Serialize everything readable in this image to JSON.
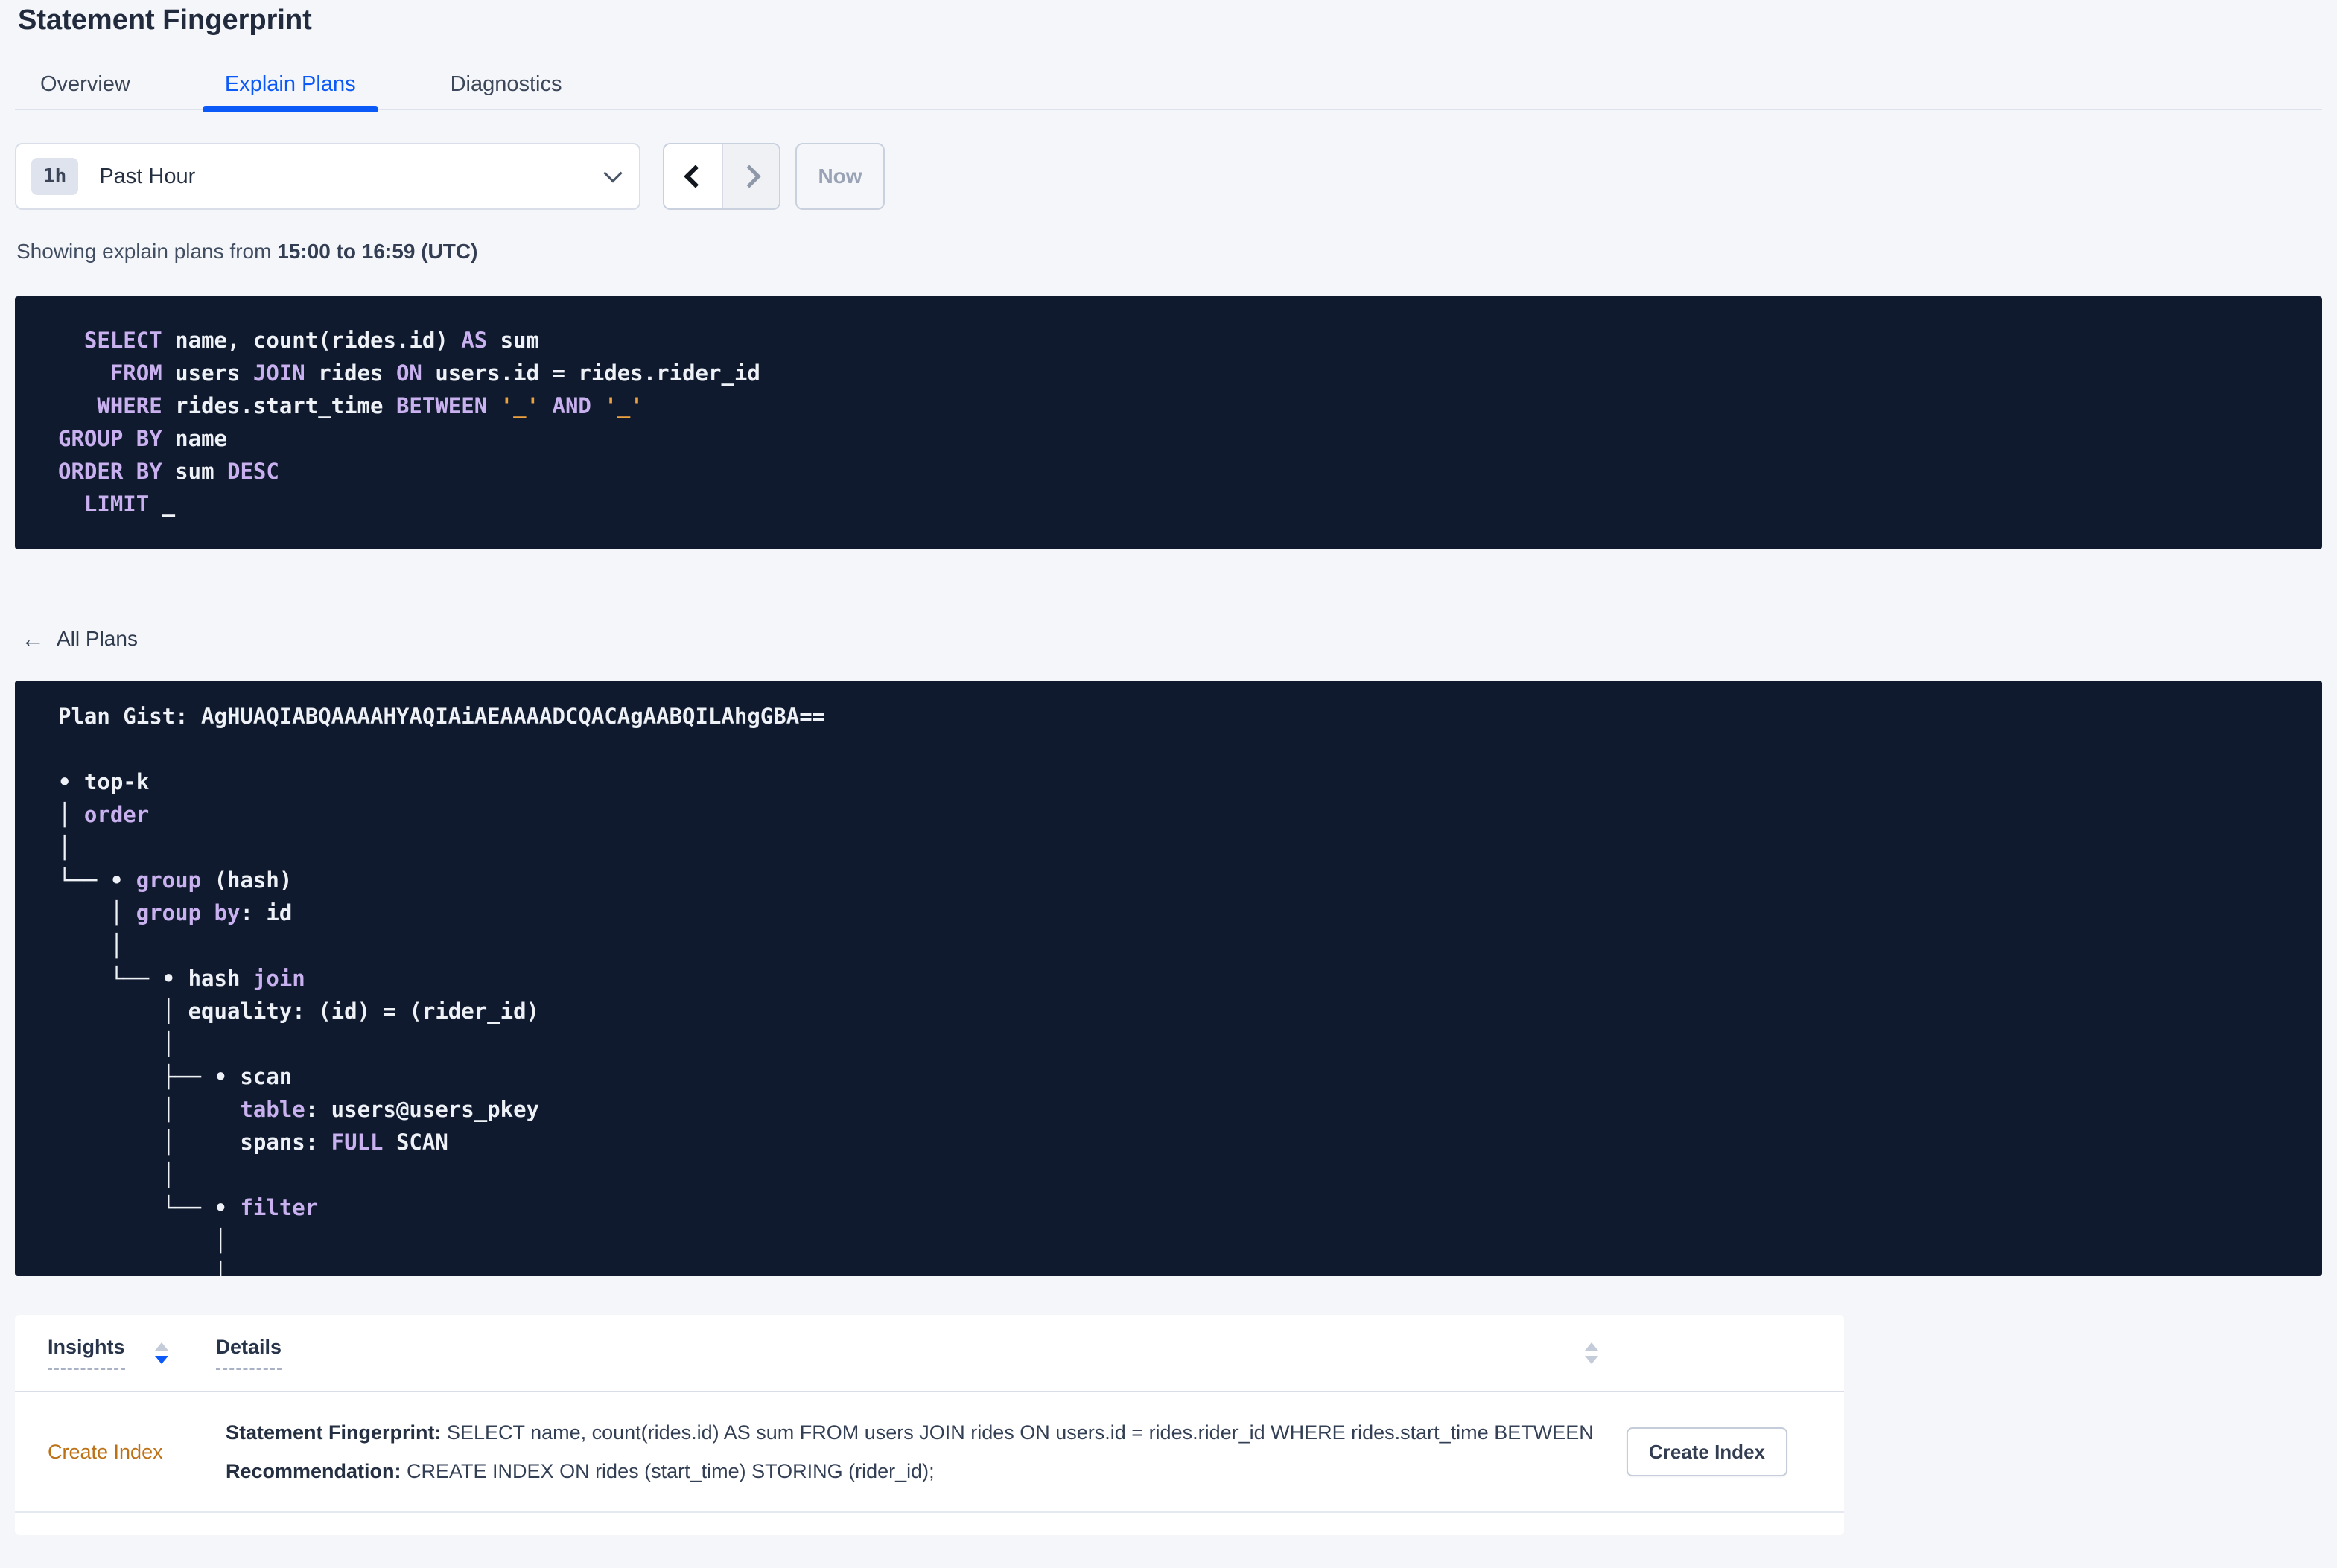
{
  "header": {
    "title": "Statement Fingerprint"
  },
  "tabs": {
    "overview": "Overview",
    "explain_plans": "Explain Plans",
    "diagnostics": "Diagnostics"
  },
  "time_picker": {
    "range_badge": "1h",
    "range_label": "Past Hour",
    "now_label": "Now"
  },
  "subheader": {
    "prefix": "Showing explain plans from ",
    "range": "15:00 to 16:59 (UTC)"
  },
  "sql_statement": {
    "lines": [
      [
        {
          "c": "kw",
          "t": "  SELECT"
        },
        {
          "c": "tx",
          "t": " name, count(rides.id) "
        },
        {
          "c": "kw",
          "t": "AS"
        },
        {
          "c": "tx",
          "t": " sum"
        }
      ],
      [
        {
          "c": "kw",
          "t": "    FROM"
        },
        {
          "c": "tx",
          "t": " users "
        },
        {
          "c": "kw",
          "t": "JOIN"
        },
        {
          "c": "tx",
          "t": " rides "
        },
        {
          "c": "kw",
          "t": "ON"
        },
        {
          "c": "tx",
          "t": " users.id = rides.rider_id"
        }
      ],
      [
        {
          "c": "kw",
          "t": "   WHERE"
        },
        {
          "c": "tx",
          "t": " rides.start_time "
        },
        {
          "c": "kw",
          "t": "BETWEEN"
        },
        {
          "c": "tx",
          "t": " "
        },
        {
          "c": "st",
          "t": "'_'"
        },
        {
          "c": "tx",
          "t": " "
        },
        {
          "c": "kw",
          "t": "AND"
        },
        {
          "c": "tx",
          "t": " "
        },
        {
          "c": "st",
          "t": "'_'"
        }
      ],
      [
        {
          "c": "kw",
          "t": "GROUP BY"
        },
        {
          "c": "tx",
          "t": " name"
        }
      ],
      [
        {
          "c": "kw",
          "t": "ORDER BY"
        },
        {
          "c": "tx",
          "t": " sum "
        },
        {
          "c": "kw",
          "t": "DESC"
        }
      ],
      [
        {
          "c": "kw",
          "t": "  LIMIT"
        },
        {
          "c": "tx",
          "t": " _"
        }
      ]
    ]
  },
  "back_link": {
    "arrow": "←",
    "label": "All Plans"
  },
  "plan": {
    "gist": "Plan Gist: AgHUAQIABQAAAAHYAQIAiAEAAAADCQACAgAABQILAhgGBA==",
    "lines": [
      [
        {
          "c": "tx",
          "t": "Plan Gist: AgHUAQIABQAAAAHYAQIAiAEAAAADCQACAgAABQILAhgGBA=="
        }
      ],
      [],
      [
        {
          "c": "tx",
          "t": "• top-k"
        }
      ],
      [
        {
          "c": "tx",
          "t": "│ "
        },
        {
          "c": "kw",
          "t": "order"
        }
      ],
      [
        {
          "c": "tx",
          "t": "│"
        }
      ],
      [
        {
          "c": "tx",
          "t": "└── • "
        },
        {
          "c": "kw",
          "t": "group"
        },
        {
          "c": "tx",
          "t": " (hash)"
        }
      ],
      [
        {
          "c": "tx",
          "t": "    │ "
        },
        {
          "c": "kw",
          "t": "group by"
        },
        {
          "c": "tx",
          "t": ": id"
        }
      ],
      [
        {
          "c": "tx",
          "t": "    │"
        }
      ],
      [
        {
          "c": "tx",
          "t": "    └── • hash "
        },
        {
          "c": "kw",
          "t": "join"
        }
      ],
      [
        {
          "c": "tx",
          "t": "        │ equality: (id) = (rider_id)"
        }
      ],
      [
        {
          "c": "tx",
          "t": "        │"
        }
      ],
      [
        {
          "c": "tx",
          "t": "        ├── • scan"
        }
      ],
      [
        {
          "c": "tx",
          "t": "        │     "
        },
        {
          "c": "kw",
          "t": "table"
        },
        {
          "c": "tx",
          "t": ": users@users_pkey"
        }
      ],
      [
        {
          "c": "tx",
          "t": "        │     spans: "
        },
        {
          "c": "kw",
          "t": "FULL"
        },
        {
          "c": "tx",
          "t": " SCAN"
        }
      ],
      [
        {
          "c": "tx",
          "t": "        │"
        }
      ],
      [
        {
          "c": "tx",
          "t": "        └── • "
        },
        {
          "c": "kw",
          "t": "filter"
        }
      ],
      [
        {
          "c": "tx",
          "t": "            │"
        }
      ],
      [
        {
          "c": "tx",
          "t": "            │"
        }
      ]
    ]
  },
  "insights_table": {
    "col_insights": "Insights",
    "col_details": "Details",
    "row": {
      "insight": "Create Index",
      "fingerprint_label": "Statement Fingerprint:",
      "fingerprint_value": " SELECT name, count(rides.id) AS sum FROM users JOIN rides ON users.id = rides.rider_id WHERE rides.start_time BETWEEN '_…",
      "recommendation_label": "Recommendation:",
      "recommendation_value": " CREATE INDEX ON rides (start_time) STORING (rider_id);",
      "action": "Create Index"
    }
  },
  "colors": {
    "accent_blue": "#0b59f7",
    "code_bg": "#0f1a2e",
    "code_keyword": "#c9b1ef",
    "code_string": "#eea23e",
    "insight_orange": "#bd7115"
  }
}
